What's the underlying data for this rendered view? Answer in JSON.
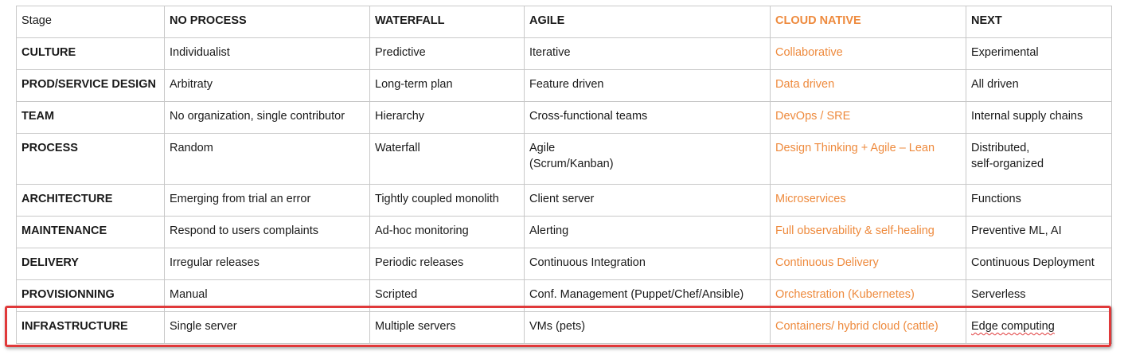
{
  "table": {
    "header": [
      "Stage",
      "NO PROCESS",
      "WATERFALL",
      "AGILE",
      "CLOUD NATIVE",
      "NEXT"
    ],
    "rows": [
      [
        "CULTURE",
        "Individualist",
        "Predictive",
        "Iterative",
        "Collaborative",
        "Experimental"
      ],
      [
        "PROD/SERVICE DESIGN",
        "Arbitraty",
        "Long-term plan",
        "Feature driven",
        "Data driven",
        "All driven"
      ],
      [
        "TEAM",
        "No organization, single contributor",
        "Hierarchy",
        "Cross-functional teams",
        "DevOps / SRE",
        "Internal supply chains"
      ],
      [
        "PROCESS",
        "Random",
        "Waterfall",
        "Agile\n(Scrum/Kanban)",
        "Design Thinking + Agile – Lean",
        "Distributed,\nself-organized"
      ],
      [
        "ARCHITECTURE",
        "Emerging from trial an error",
        "Tightly coupled monolith",
        "Client server",
        "Microservices",
        "Functions"
      ],
      [
        "MAINTENANCE",
        "Respond to users complaints",
        "Ad-hoc monitoring",
        "Alerting",
        "Full observability & self-healing",
        "Preventive ML, AI"
      ],
      [
        "DELIVERY",
        "Irregular releases",
        "Periodic releases",
        "Continuous Integration",
        "Continuous Delivery",
        "Continuous Deployment"
      ],
      [
        "PROVISIONNING",
        "Manual",
        "Scripted",
        "Conf. Management (Puppet/Chef/Ansible)",
        "Orchestration (Kubernetes)",
        "Serverless"
      ],
      [
        "INFRASTRUCTURE",
        "Single server",
        "Multiple servers",
        "VMs (pets)",
        "Containers/ hybrid cloud (cattle)",
        "Edge computing"
      ]
    ]
  },
  "colors": {
    "accent": "#ee8a3d",
    "highlight_border": "#e0393a",
    "grid_line": "#c8c8c8",
    "text": "#1a1a1a"
  }
}
